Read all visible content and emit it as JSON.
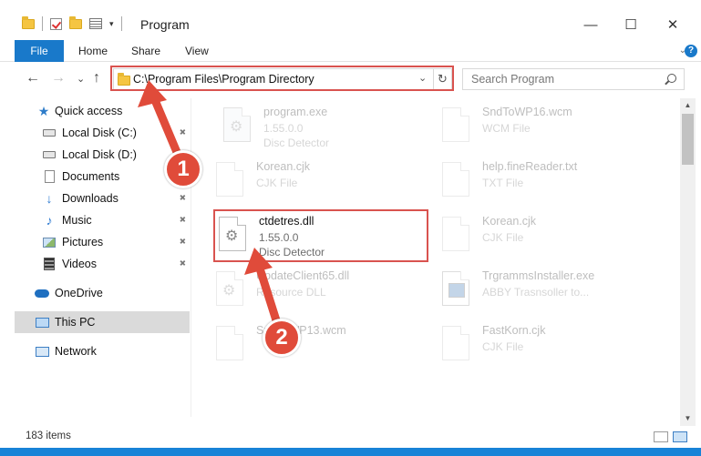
{
  "window": {
    "title": "Program",
    "minimize": "—",
    "maximize": "☐",
    "close": "✕"
  },
  "ribbon": {
    "tabs": [
      "File",
      "Home",
      "Share",
      "View"
    ],
    "expand_caret": "⌄",
    "help": "?"
  },
  "navigation": {
    "back": "←",
    "forward": "→",
    "recent": "⌄",
    "up": "↑",
    "address": "C:\\Program Files\\Program Directory",
    "address_dropdown": "⌄",
    "refresh": "↻",
    "search_placeholder": "Search Program"
  },
  "sidebar": {
    "items": [
      {
        "label": "Quick access",
        "icon": "star-icon",
        "pinned": false
      },
      {
        "label": "Local Disk (C:)",
        "icon": "drive-icon",
        "pinned": true
      },
      {
        "label": "Local Disk (D:)",
        "icon": "drive-icon",
        "pinned": false
      },
      {
        "label": "Documents",
        "icon": "document-icon",
        "pinned": true
      },
      {
        "label": "Downloads",
        "icon": "download-icon",
        "pinned": true
      },
      {
        "label": "Music",
        "icon": "music-icon",
        "pinned": true
      },
      {
        "label": "Pictures",
        "icon": "pictures-icon",
        "pinned": true
      },
      {
        "label": "Videos",
        "icon": "video-icon",
        "pinned": true
      },
      {
        "label": "OneDrive",
        "icon": "cloud-icon",
        "pinned": false
      },
      {
        "label": "This PC",
        "icon": "computer-icon",
        "pinned": false,
        "selected": true
      },
      {
        "label": "Network",
        "icon": "network-icon",
        "pinned": false
      }
    ]
  },
  "files": [
    {
      "name": "program.exe",
      "line2": "1.55.0.0",
      "line3": "Disc Detector",
      "icon": "exe-icon",
      "faded": true
    },
    {
      "name": "SndToWP16.wcm",
      "line2": "WCM File",
      "line3": "",
      "icon": "file-icon",
      "faded": true
    },
    {
      "name": "Korean.cjk",
      "line2": "CJK File",
      "line3": "",
      "icon": "file-icon",
      "faded": true
    },
    {
      "name": "help.fineReader.txt",
      "line2": "TXT File",
      "line3": "",
      "icon": "file-icon",
      "faded": true
    },
    {
      "name": "ctdetres.dll",
      "line2": "1.55.0.0",
      "line3": "Disc Detector",
      "icon": "dll-gear-icon",
      "faded": false
    },
    {
      "name": "Korean.cjk",
      "line2": "CJK File",
      "line3": "",
      "icon": "file-icon",
      "faded": true
    },
    {
      "name": "UpdateClient65.dll",
      "line2": "Resource DLL",
      "line3": "",
      "icon": "dll-gear-icon",
      "faded": true
    },
    {
      "name": "TrgrammsInstaller.exe",
      "line2": "ABBY Trasnsoller to...",
      "line3": "",
      "icon": "window-icon",
      "faded": true
    },
    {
      "name": "SndToWP13.wcm",
      "line2": "",
      "line3": "",
      "icon": "file-icon",
      "faded": true
    },
    {
      "name": "FastKorn.cjk",
      "line2": "CJK File",
      "line3": "",
      "icon": "file-icon",
      "faded": true
    }
  ],
  "status": {
    "item_count": "183 items"
  },
  "annotations": {
    "step1": "1",
    "step2": "2",
    "color": "#e04b3a"
  },
  "colors": {
    "accent": "#1979ca",
    "highlight": "#d9534f",
    "taskbar": "#1883d7"
  }
}
